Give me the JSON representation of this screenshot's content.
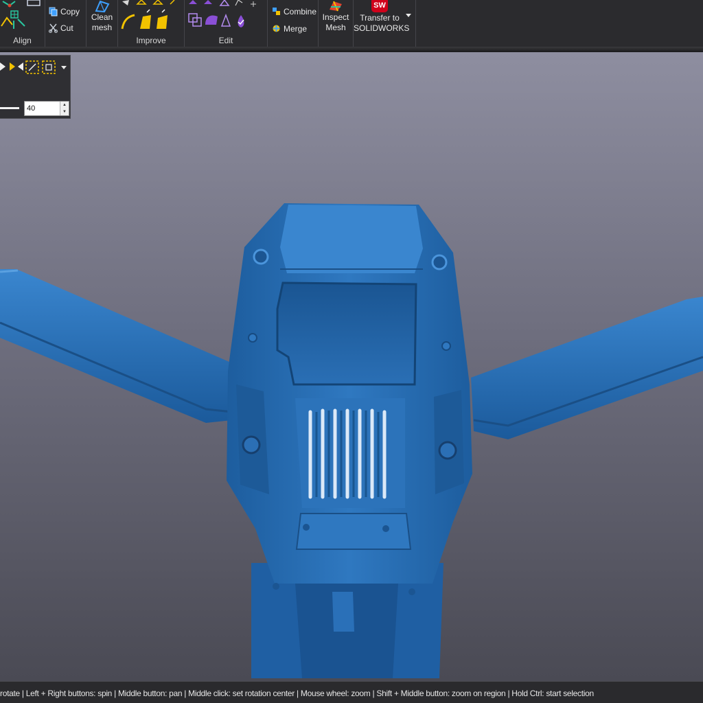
{
  "ribbon": {
    "groups": {
      "align": {
        "label": "Align"
      },
      "clipboard": {
        "copy": "Copy",
        "cut": "Cut"
      },
      "clean": {
        "label": "Clean\nmesh",
        "line1": "Clean",
        "line2": "mesh"
      },
      "improve": {
        "label": "Improve"
      },
      "edit": {
        "label": "Edit"
      },
      "combine": {
        "combine": "Combine",
        "merge": "Merge"
      },
      "inspect": {
        "line1": "Inspect",
        "line2": "Mesh"
      },
      "transfer": {
        "line1": "Transfer to",
        "line2": "SOLIDWORKS",
        "logo_text": "SW"
      }
    }
  },
  "tool_panel": {
    "value": "40"
  },
  "status_bar": {
    "text": "rotate  |  Left + Right buttons: spin  |  Middle button: pan  |  Middle click: set rotation center  |  Mouse wheel: zoom  |  Shift + Middle button: zoom on region  |  Hold Ctrl: start selection"
  },
  "colors": {
    "mesh_blue": "#2a6fb5",
    "accent_yellow": "#f2c200",
    "accent_purple": "#8a4fd6",
    "solidworks_red": "#d0021b"
  }
}
